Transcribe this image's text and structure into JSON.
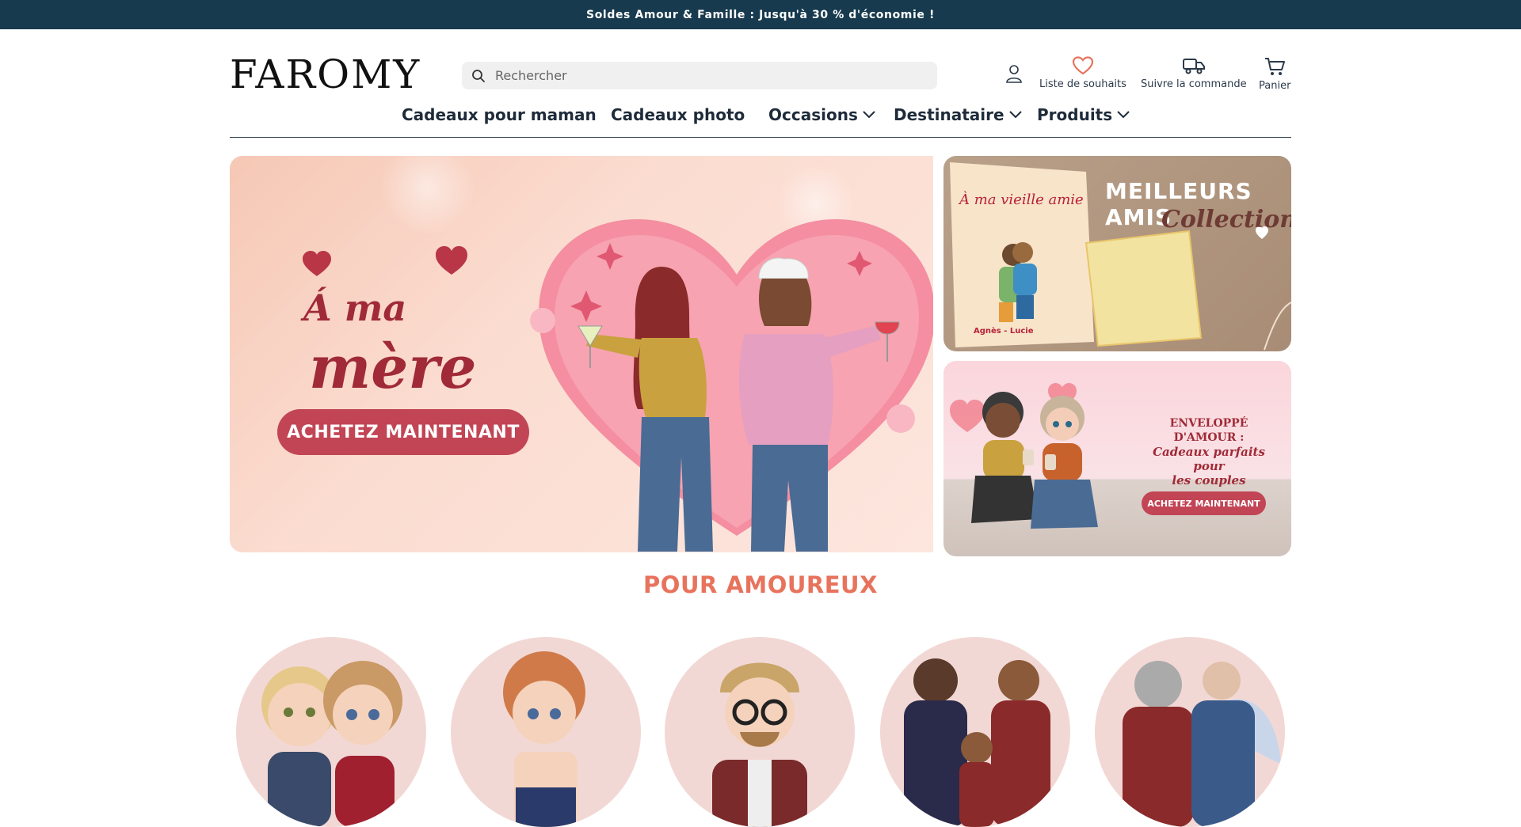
{
  "announcement": "Soldes Amour & Famille : Jusqu'à 30 % d'économie !",
  "brand": {
    "logo": "FAROMY"
  },
  "search": {
    "placeholder": "Rechercher"
  },
  "header_actions": {
    "account_icon": "user-icon",
    "wishlist_label": "Liste de souhaits",
    "track_label": "Suivre la commande",
    "cart_label": "Panier"
  },
  "nav": {
    "items": [
      {
        "label": "Cadeaux pour maman",
        "has_dropdown": false
      },
      {
        "label": "Cadeaux photo",
        "has_dropdown": false
      },
      {
        "label": "Occasions",
        "has_dropdown": true
      },
      {
        "label": "Destinataire",
        "has_dropdown": true
      },
      {
        "label": "Produits",
        "has_dropdown": true
      }
    ]
  },
  "hero": {
    "title_line1": "Á ma",
    "title_line2": "mère",
    "cta": "ACHETEZ MAINTENANT"
  },
  "promo_top": {
    "title_line1": "MEILLEURS AMIS",
    "title_line2": "Collection",
    "pillow_text": "À ma vieille amie",
    "names": "Agnès - Lucie"
  },
  "promo_bottom": {
    "title_line1": "ENVELOPPÉ D'AMOUR :",
    "title_line2": "Cadeaux parfaits pour",
    "title_line3": "les couples",
    "cta": "ACHETEZ MAINTENANT"
  },
  "section": {
    "title": "POUR AMOUREUX"
  },
  "colors": {
    "topbar": "#173a4e",
    "accent": "#e8735d",
    "hero_button": "#c24555",
    "wishlist_heart": "#e8735d"
  }
}
